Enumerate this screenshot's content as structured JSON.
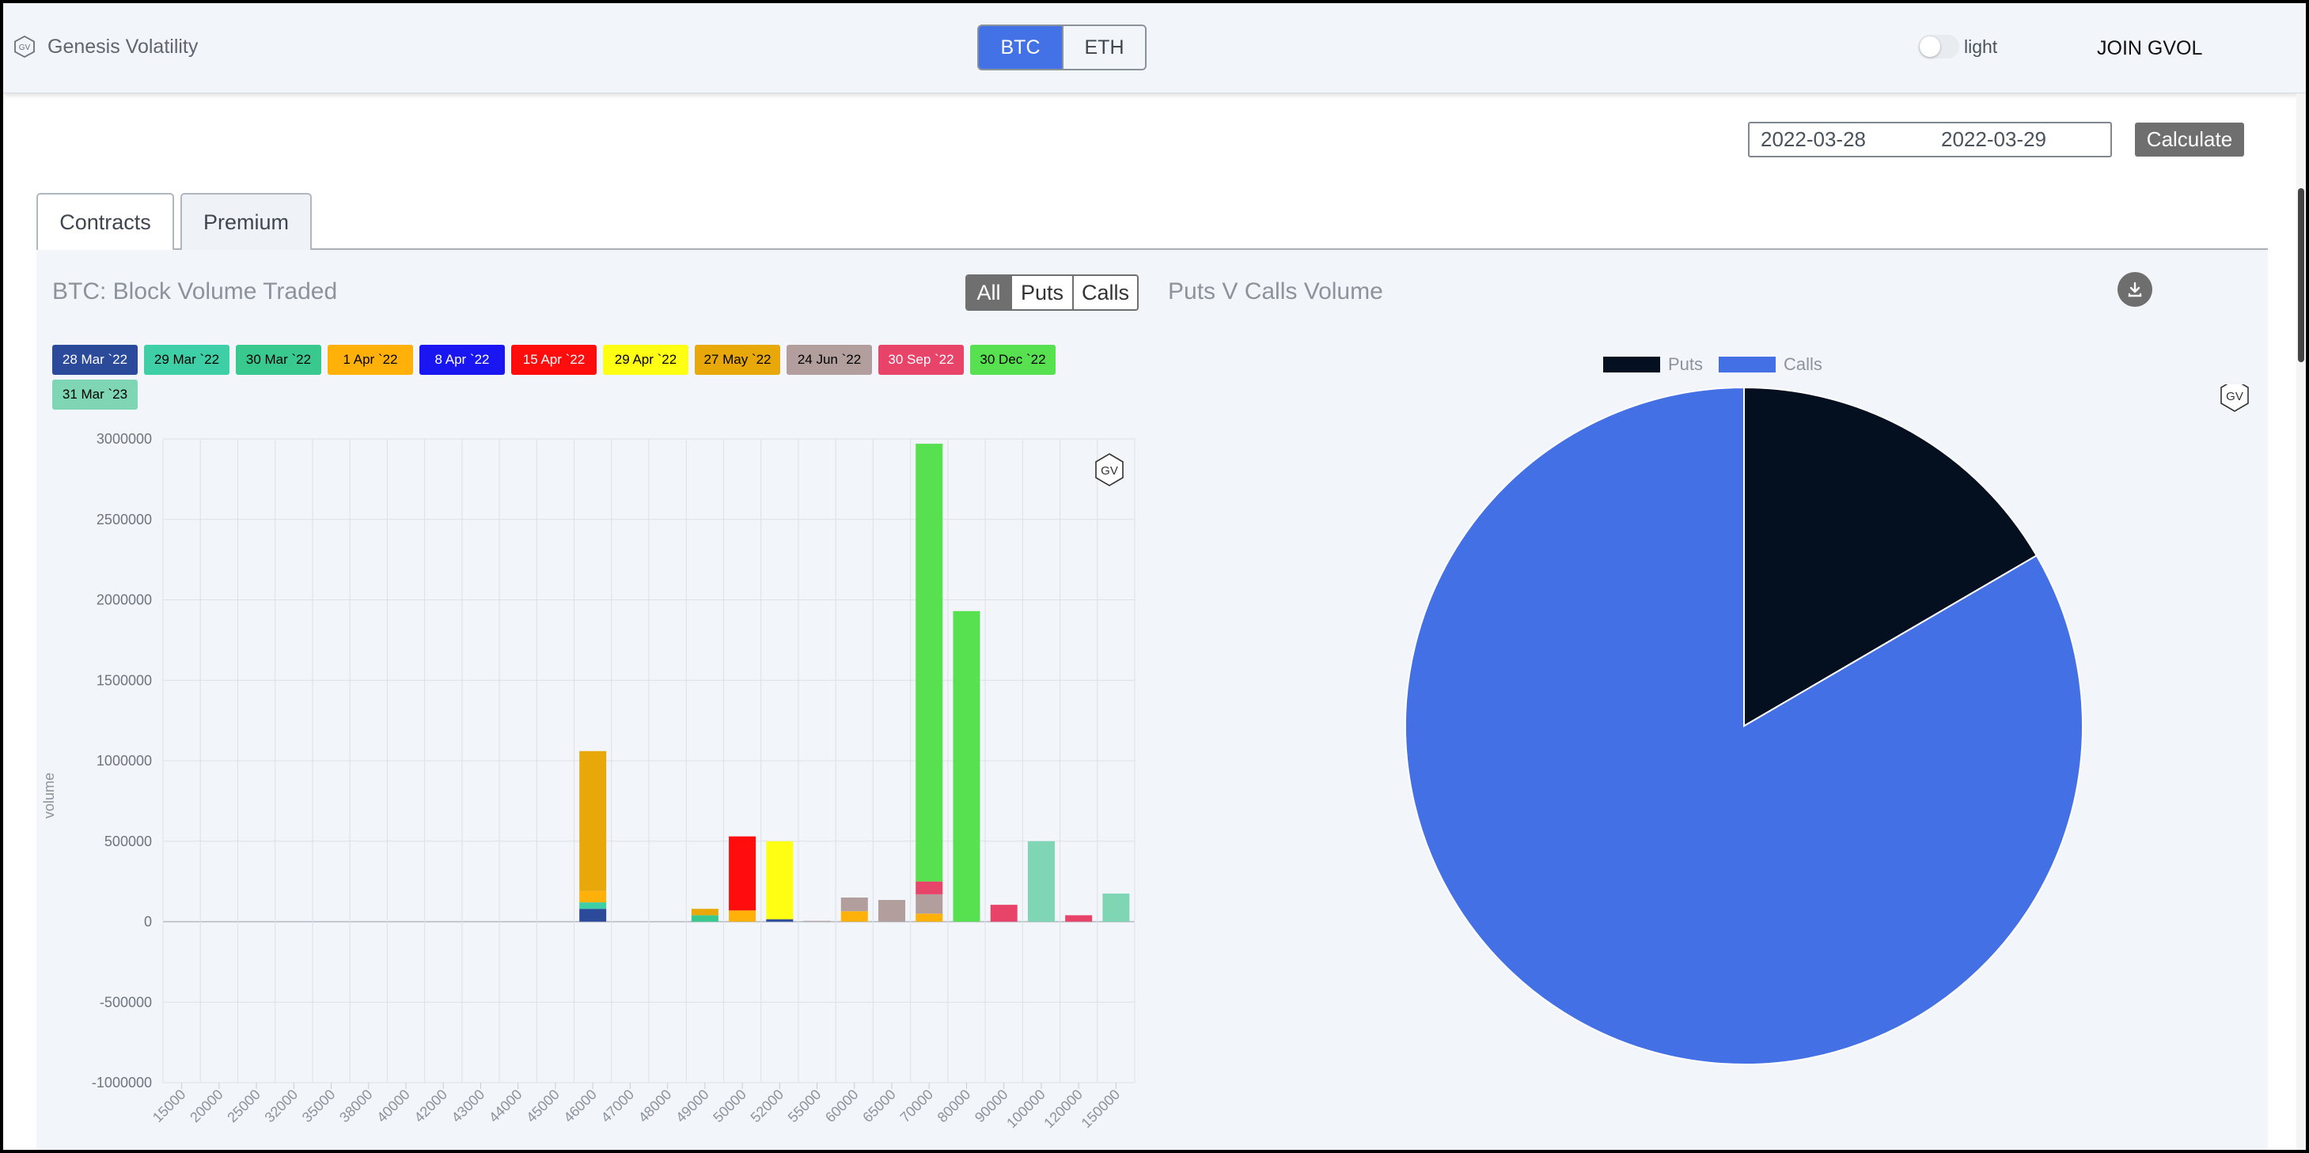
{
  "header": {
    "brand_icon_text": "GV",
    "brand_name": "Genesis Volatility",
    "assets": [
      "BTC",
      "ETH"
    ],
    "active_asset": "BTC",
    "theme_label": "light",
    "join_label": "JOIN GVOL"
  },
  "controls": {
    "start_date": "2022-03-28",
    "end_date": "2022-03-29",
    "calculate_label": "Calculate"
  },
  "tabs": [
    {
      "label": "Contracts",
      "active": false
    },
    {
      "label": "Premium",
      "active": true
    }
  ],
  "filters": {
    "options": [
      "All",
      "Puts",
      "Calls"
    ],
    "active": "All"
  },
  "expiries": [
    {
      "label": "28 Mar `22",
      "color": "#2b4a9a",
      "text": "#ffffff"
    },
    {
      "label": "29 Mar `22",
      "color": "#3ecfa6",
      "text": "#000000"
    },
    {
      "label": "30 Mar `22",
      "color": "#39c98f",
      "text": "#000000"
    },
    {
      "label": "1 Apr `22",
      "color": "#ffb10a",
      "text": "#000000"
    },
    {
      "label": "8 Apr `22",
      "color": "#1a16f2",
      "text": "#ffffff"
    },
    {
      "label": "15 Apr `22",
      "color": "#ff0d0d",
      "text": "#ffffff"
    },
    {
      "label": "29 Apr `22",
      "color": "#ffff14",
      "text": "#000000"
    },
    {
      "label": "27 May `22",
      "color": "#e8a80a",
      "text": "#000000"
    },
    {
      "label": "24 Jun `22",
      "color": "#b19e9d",
      "text": "#000000"
    },
    {
      "label": "30 Sep `22",
      "color": "#e8446a",
      "text": "#ffffff"
    },
    {
      "label": "30 Dec `22",
      "color": "#57e04f",
      "text": "#000000"
    },
    {
      "label": "31 Mar `23",
      "color": "#7ed6b4",
      "text": "#000000"
    }
  ],
  "chart_data": [
    {
      "type": "bar",
      "title": "BTC: Block Volume Traded",
      "ylabel": "volume",
      "ylim": [
        -1000000,
        3000000
      ],
      "yticks": [
        3000000,
        2500000,
        2000000,
        1500000,
        1000000,
        500000,
        0,
        -500000,
        -1000000
      ],
      "grid": true,
      "stacked": true,
      "watermark": "GV",
      "categories": [
        "15000",
        "20000",
        "25000",
        "32000",
        "35000",
        "38000",
        "40000",
        "42000",
        "43000",
        "44000",
        "45000",
        "46000",
        "47000",
        "48000",
        "49000",
        "50000",
        "52000",
        "55000",
        "60000",
        "65000",
        "70000",
        "80000",
        "90000",
        "100000",
        "120000",
        "150000"
      ],
      "series": [
        {
          "name": "28 Mar `22",
          "values": [
            0,
            0,
            0,
            0,
            0,
            0,
            0,
            0,
            0,
            0,
            0,
            80000,
            0,
            0,
            0,
            0,
            15000,
            0,
            0,
            0,
            0,
            0,
            0,
            0,
            0,
            0
          ]
        },
        {
          "name": "29 Mar `22",
          "values": [
            0,
            0,
            0,
            0,
            0,
            0,
            0,
            0,
            0,
            0,
            0,
            40000,
            0,
            0,
            0,
            0,
            0,
            0,
            0,
            0,
            0,
            0,
            0,
            0,
            0,
            0
          ]
        },
        {
          "name": "30 Mar `22",
          "values": [
            0,
            0,
            0,
            0,
            0,
            0,
            0,
            0,
            0,
            0,
            0,
            0,
            0,
            0,
            40000,
            0,
            0,
            0,
            0,
            0,
            0,
            0,
            0,
            0,
            0,
            0
          ]
        },
        {
          "name": "1 Apr `22",
          "values": [
            0,
            0,
            0,
            0,
            0,
            0,
            0,
            0,
            0,
            0,
            0,
            70000,
            0,
            0,
            0,
            70000,
            0,
            0,
            65000,
            0,
            50000,
            0,
            0,
            0,
            0,
            0
          ]
        },
        {
          "name": "8 Apr `22",
          "values": [
            0,
            0,
            0,
            0,
            0,
            0,
            0,
            0,
            0,
            0,
            0,
            0,
            0,
            0,
            0,
            0,
            0,
            0,
            0,
            0,
            0,
            0,
            0,
            0,
            0,
            0
          ]
        },
        {
          "name": "15 Apr `22",
          "values": [
            0,
            0,
            0,
            0,
            0,
            0,
            0,
            0,
            0,
            0,
            0,
            0,
            0,
            0,
            0,
            460000,
            0,
            0,
            0,
            0,
            0,
            0,
            0,
            0,
            0,
            0
          ]
        },
        {
          "name": "29 Apr `22",
          "values": [
            0,
            0,
            0,
            0,
            0,
            0,
            0,
            0,
            0,
            0,
            0,
            0,
            0,
            0,
            0,
            0,
            485000,
            0,
            0,
            0,
            0,
            0,
            0,
            0,
            0,
            0
          ]
        },
        {
          "name": "27 May `22",
          "values": [
            0,
            0,
            0,
            0,
            0,
            0,
            0,
            0,
            0,
            0,
            0,
            870000,
            0,
            0,
            40000,
            0,
            0,
            0,
            0,
            0,
            0,
            0,
            0,
            0,
            0,
            0
          ]
        },
        {
          "name": "24 Jun `22",
          "values": [
            0,
            0,
            0,
            0,
            0,
            0,
            0,
            0,
            0,
            0,
            0,
            0,
            0,
            0,
            0,
            0,
            0,
            5000,
            85000,
            135000,
            120000,
            0,
            0,
            0,
            0,
            0
          ]
        },
        {
          "name": "30 Sep `22",
          "values": [
            0,
            0,
            0,
            0,
            0,
            0,
            0,
            0,
            0,
            0,
            0,
            0,
            0,
            0,
            0,
            0,
            0,
            0,
            0,
            0,
            80000,
            0,
            105000,
            0,
            40000,
            0
          ]
        },
        {
          "name": "30 Dec `22",
          "values": [
            0,
            0,
            0,
            0,
            0,
            0,
            0,
            0,
            0,
            0,
            0,
            0,
            0,
            0,
            0,
            0,
            0,
            0,
            0,
            0,
            2720000,
            1930000,
            0,
            0,
            0,
            0
          ]
        },
        {
          "name": "31 Mar `23",
          "values": [
            0,
            0,
            0,
            0,
            0,
            0,
            0,
            0,
            0,
            0,
            0,
            0,
            0,
            0,
            0,
            0,
            0,
            0,
            0,
            0,
            0,
            0,
            0,
            500000,
            0,
            175000
          ]
        }
      ]
    },
    {
      "type": "pie",
      "title": "Puts V Calls Volume",
      "legend": "top",
      "watermark": "GV",
      "labels": [
        "Puts",
        "Calls"
      ],
      "values": [
        16.6,
        83.4
      ],
      "colors": [
        "#040f1f",
        "#4470e6"
      ]
    }
  ]
}
